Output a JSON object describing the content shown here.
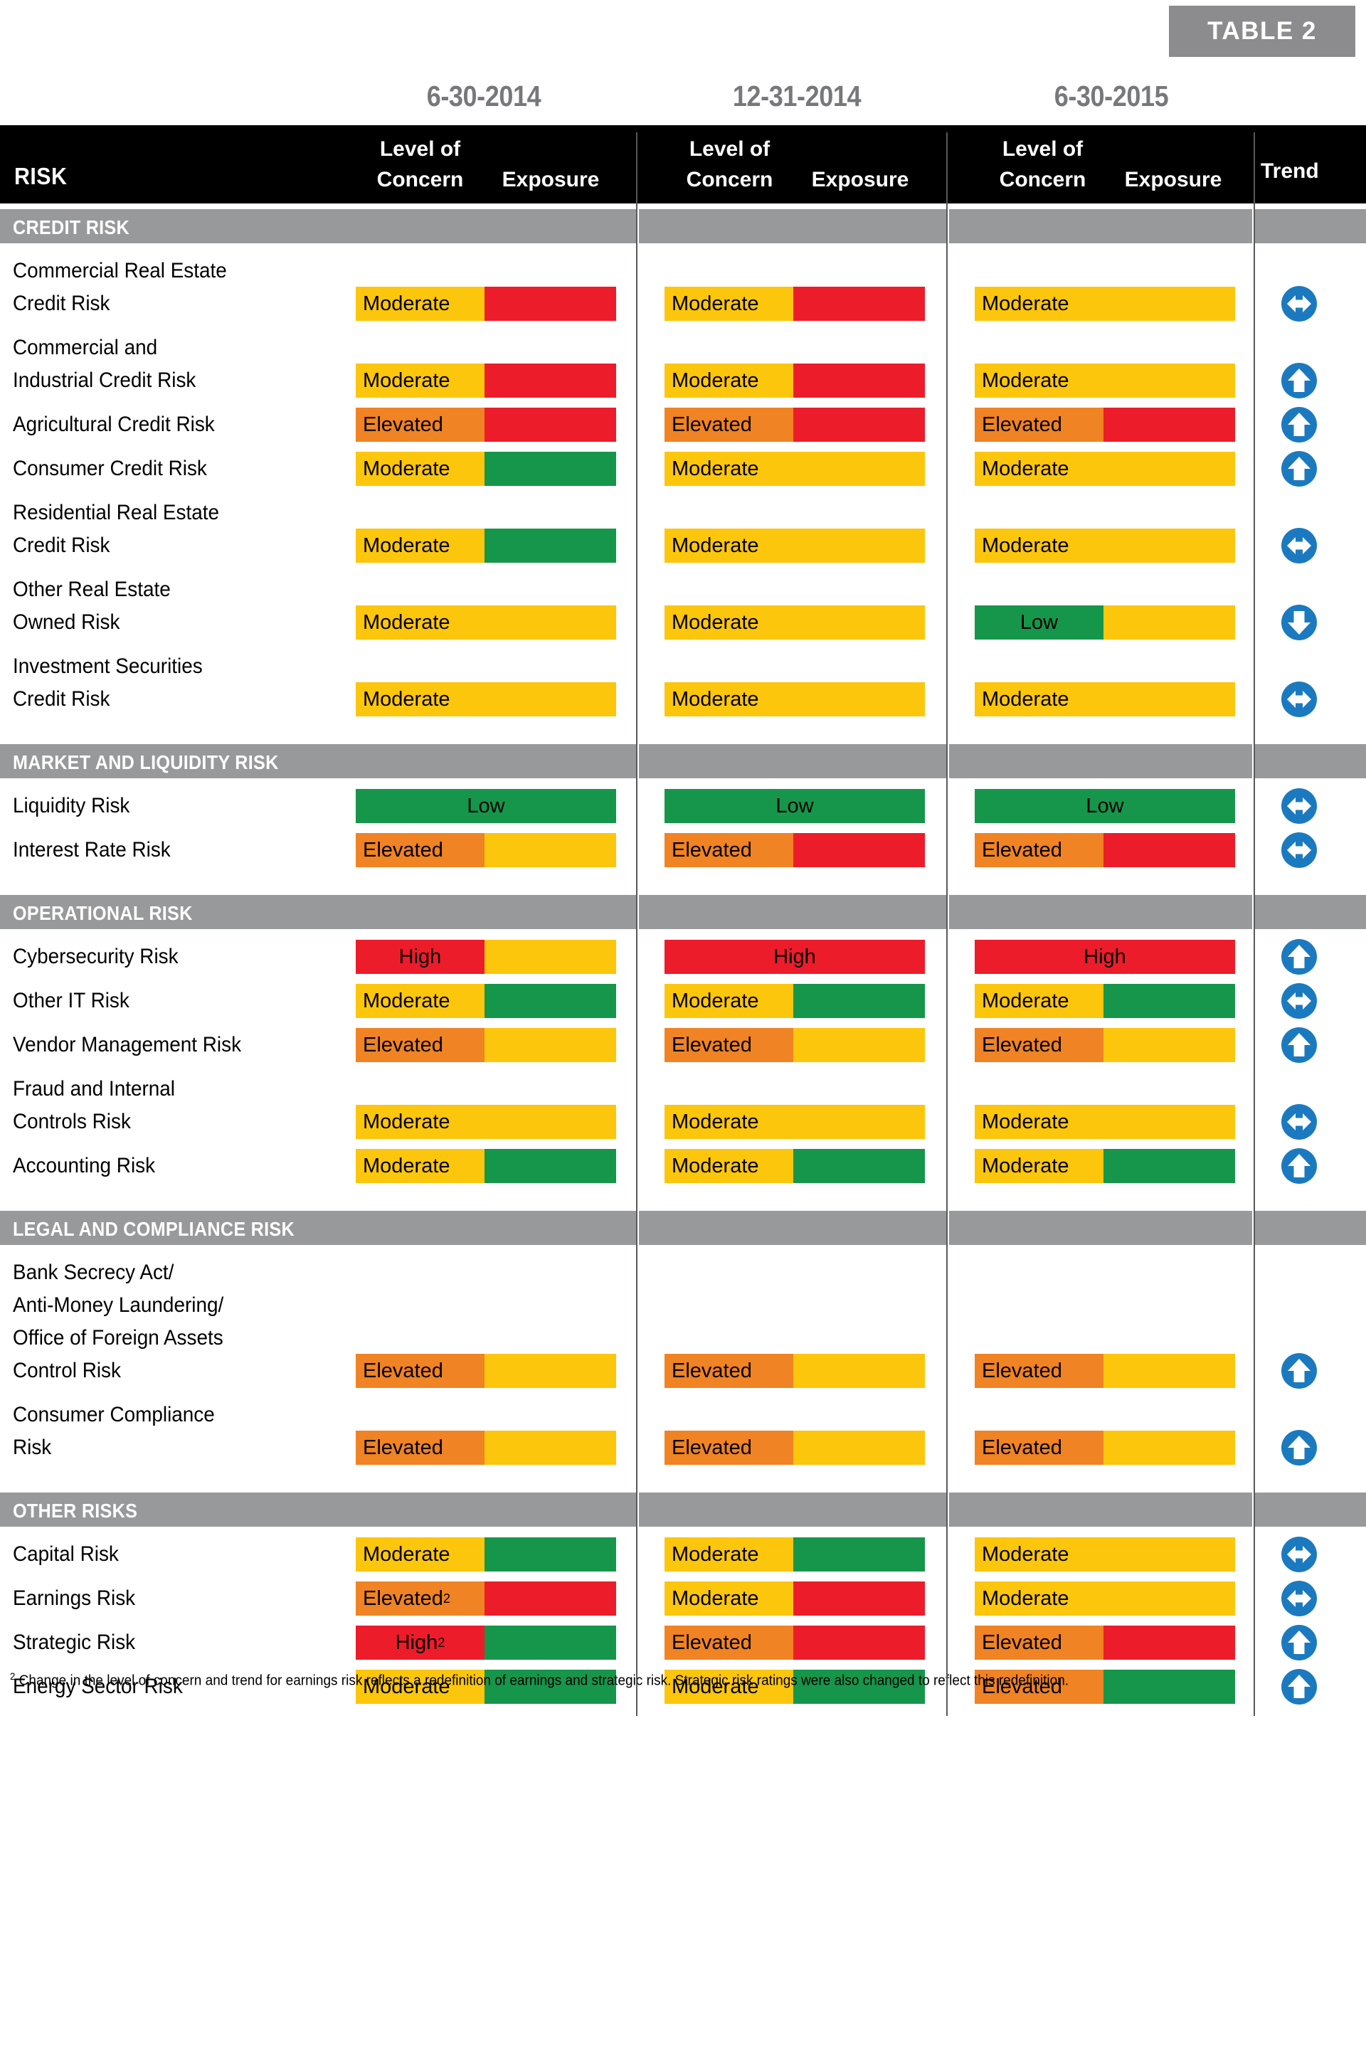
{
  "badge": {
    "label": "TABLE 2"
  },
  "colors": {
    "low": "#16964a",
    "moderate": "#fcc60c",
    "elevated": "#f08323",
    "high": "#ed1c2a",
    "band": "#97999b",
    "header_bg": "#000000",
    "trend_blue": "#1b7abf",
    "date_text": "#77787b"
  },
  "header": {
    "risk_label": "RISK",
    "trend_label": "Trend",
    "dates": [
      "6-30-2014",
      "12-31-2014",
      "6-30-2015"
    ],
    "sub_concern": "Level of\nConcern",
    "sub_concern_line1": "Level of",
    "sub_concern_line2": "Concern",
    "sub_exposure": "Exposure"
  },
  "sections": [
    {
      "title": "CREDIT RISK",
      "rows": [
        {
          "label": "Commercial Real Estate\nCredit Risk",
          "label_lines": [
            "Commercial Real Estate",
            "Credit Risk"
          ],
          "periods": [
            {
              "concern": "Moderate",
              "concern_color": "moderate",
              "exposure_color": "high"
            },
            {
              "concern": "Moderate",
              "concern_color": "moderate",
              "exposure_color": "high"
            },
            {
              "concern": "Moderate",
              "concern_color": "moderate",
              "exposure_color": "moderate"
            }
          ],
          "trend": "flat"
        },
        {
          "label": "Commercial and\nIndustrial Credit Risk",
          "label_lines": [
            "Commercial and",
            "Industrial Credit Risk"
          ],
          "periods": [
            {
              "concern": "Moderate",
              "concern_color": "moderate",
              "exposure_color": "high"
            },
            {
              "concern": "Moderate",
              "concern_color": "moderate",
              "exposure_color": "high"
            },
            {
              "concern": "Moderate",
              "concern_color": "moderate",
              "exposure_color": "moderate"
            }
          ],
          "trend": "up"
        },
        {
          "label": "Agricultural Credit Risk",
          "label_lines": [
            "Agricultural Credit Risk"
          ],
          "periods": [
            {
              "concern": "Elevated",
              "concern_color": "elevated",
              "exposure_color": "high"
            },
            {
              "concern": "Elevated",
              "concern_color": "elevated",
              "exposure_color": "high"
            },
            {
              "concern": "Elevated",
              "concern_color": "elevated",
              "exposure_color": "high"
            }
          ],
          "trend": "up"
        },
        {
          "label": "Consumer Credit Risk",
          "label_lines": [
            "Consumer Credit Risk"
          ],
          "periods": [
            {
              "concern": "Moderate",
              "concern_color": "moderate",
              "exposure_color": "low"
            },
            {
              "concern": "Moderate",
              "concern_color": "moderate",
              "exposure_color": "moderate"
            },
            {
              "concern": "Moderate",
              "concern_color": "moderate",
              "exposure_color": "moderate"
            }
          ],
          "trend": "up"
        },
        {
          "label": "Residential Real Estate\nCredit Risk",
          "label_lines": [
            "Residential Real Estate",
            "Credit Risk"
          ],
          "periods": [
            {
              "concern": "Moderate",
              "concern_color": "moderate",
              "exposure_color": "low"
            },
            {
              "concern": "Moderate",
              "concern_color": "moderate",
              "exposure_color": "moderate"
            },
            {
              "concern": "Moderate",
              "concern_color": "moderate",
              "exposure_color": "moderate"
            }
          ],
          "trend": "flat"
        },
        {
          "label": "Other Real Estate\nOwned Risk",
          "label_lines": [
            "Other Real Estate",
            "Owned Risk"
          ],
          "periods": [
            {
              "concern": "Moderate",
              "concern_color": "moderate",
              "exposure_color": "moderate"
            },
            {
              "concern": "Moderate",
              "concern_color": "moderate",
              "exposure_color": "moderate"
            },
            {
              "concern": "Low",
              "concern_color": "low",
              "exposure_color": "moderate",
              "center": true
            }
          ],
          "trend": "down"
        },
        {
          "label": "Investment Securities\nCredit Risk",
          "label_lines": [
            "Investment Securities",
            "Credit Risk"
          ],
          "periods": [
            {
              "concern": "Moderate",
              "concern_color": "moderate",
              "exposure_color": "moderate"
            },
            {
              "concern": "Moderate",
              "concern_color": "moderate",
              "exposure_color": "moderate"
            },
            {
              "concern": "Moderate",
              "concern_color": "moderate",
              "exposure_color": "moderate"
            }
          ],
          "trend": "flat"
        }
      ]
    },
    {
      "title": "MARKET AND LIQUIDITY RISK",
      "rows": [
        {
          "label": "Liquidity Risk",
          "label_lines": [
            "Liquidity Risk"
          ],
          "periods": [
            {
              "concern": "Low",
              "concern_color": "low",
              "exposure_color": "low",
              "center": true
            },
            {
              "concern": "Low",
              "concern_color": "low",
              "exposure_color": "low",
              "center": true
            },
            {
              "concern": "Low",
              "concern_color": "low",
              "exposure_color": "low",
              "center": true
            }
          ],
          "trend": "flat"
        },
        {
          "label": "Interest Rate Risk",
          "label_lines": [
            "Interest Rate Risk"
          ],
          "periods": [
            {
              "concern": "Elevated",
              "concern_color": "elevated",
              "exposure_color": "moderate"
            },
            {
              "concern": "Elevated",
              "concern_color": "elevated",
              "exposure_color": "high"
            },
            {
              "concern": "Elevated",
              "concern_color": "elevated",
              "exposure_color": "high"
            }
          ],
          "trend": "flat"
        }
      ]
    },
    {
      "title": "OPERATIONAL RISK",
      "rows": [
        {
          "label": "Cybersecurity Risk",
          "label_lines": [
            "Cybersecurity Risk"
          ],
          "periods": [
            {
              "concern": "High",
              "concern_color": "high",
              "exposure_color": "moderate",
              "center": true
            },
            {
              "concern": "High",
              "concern_color": "high",
              "exposure_color": "high",
              "center": true
            },
            {
              "concern": "High",
              "concern_color": "high",
              "exposure_color": "high",
              "center": true
            }
          ],
          "trend": "up"
        },
        {
          "label": "Other IT Risk",
          "label_lines": [
            "Other IT Risk"
          ],
          "periods": [
            {
              "concern": "Moderate",
              "concern_color": "moderate",
              "exposure_color": "low"
            },
            {
              "concern": "Moderate",
              "concern_color": "moderate",
              "exposure_color": "low"
            },
            {
              "concern": "Moderate",
              "concern_color": "moderate",
              "exposure_color": "low"
            }
          ],
          "trend": "flat"
        },
        {
          "label": "Vendor Management Risk",
          "label_lines": [
            "Vendor Management Risk"
          ],
          "periods": [
            {
              "concern": "Elevated",
              "concern_color": "elevated",
              "exposure_color": "moderate"
            },
            {
              "concern": "Elevated",
              "concern_color": "elevated",
              "exposure_color": "moderate"
            },
            {
              "concern": "Elevated",
              "concern_color": "elevated",
              "exposure_color": "moderate"
            }
          ],
          "trend": "up"
        },
        {
          "label": "Fraud and Internal\nControls Risk",
          "label_lines": [
            "Fraud and Internal",
            "Controls Risk"
          ],
          "periods": [
            {
              "concern": "Moderate",
              "concern_color": "moderate",
              "exposure_color": "moderate"
            },
            {
              "concern": "Moderate",
              "concern_color": "moderate",
              "exposure_color": "moderate"
            },
            {
              "concern": "Moderate",
              "concern_color": "moderate",
              "exposure_color": "moderate"
            }
          ],
          "trend": "flat"
        },
        {
          "label": "Accounting Risk",
          "label_lines": [
            "Accounting Risk"
          ],
          "periods": [
            {
              "concern": "Moderate",
              "concern_color": "moderate",
              "exposure_color": "low"
            },
            {
              "concern": "Moderate",
              "concern_color": "moderate",
              "exposure_color": "low"
            },
            {
              "concern": "Moderate",
              "concern_color": "moderate",
              "exposure_color": "low"
            }
          ],
          "trend": "up"
        }
      ]
    },
    {
      "title": "LEGAL AND COMPLIANCE RISK",
      "rows": [
        {
          "label": "Bank Secrecy Act/\nAnti-Money Laundering/\nOffice of Foreign Assets\nControl Risk",
          "label_lines": [
            "Bank Secrecy Act/",
            "Anti-Money Laundering/",
            "Office of Foreign Assets",
            "Control Risk"
          ],
          "periods": [
            {
              "concern": "Elevated",
              "concern_color": "elevated",
              "exposure_color": "moderate"
            },
            {
              "concern": "Elevated",
              "concern_color": "elevated",
              "exposure_color": "moderate"
            },
            {
              "concern": "Elevated",
              "concern_color": "elevated",
              "exposure_color": "moderate"
            }
          ],
          "trend": "up"
        },
        {
          "label": "Consumer Compliance\nRisk",
          "label_lines": [
            "Consumer Compliance",
            "Risk"
          ],
          "periods": [
            {
              "concern": "Elevated",
              "concern_color": "elevated",
              "exposure_color": "moderate"
            },
            {
              "concern": "Elevated",
              "concern_color": "elevated",
              "exposure_color": "moderate"
            },
            {
              "concern": "Elevated",
              "concern_color": "elevated",
              "exposure_color": "moderate"
            }
          ],
          "trend": "up"
        }
      ]
    },
    {
      "title": "OTHER RISKS",
      "rows": [
        {
          "label": "Capital Risk",
          "label_lines": [
            "Capital Risk"
          ],
          "periods": [
            {
              "concern": "Moderate",
              "concern_color": "moderate",
              "exposure_color": "low"
            },
            {
              "concern": "Moderate",
              "concern_color": "moderate",
              "exposure_color": "low"
            },
            {
              "concern": "Moderate",
              "concern_color": "moderate",
              "exposure_color": "moderate"
            }
          ],
          "trend": "flat"
        },
        {
          "label": "Earnings Risk",
          "label_lines": [
            "Earnings Risk"
          ],
          "periods": [
            {
              "concern": "Elevated",
              "footnote": "2",
              "concern_color": "elevated",
              "exposure_color": "high"
            },
            {
              "concern": "Moderate",
              "concern_color": "moderate",
              "exposure_color": "high"
            },
            {
              "concern": "Moderate",
              "concern_color": "moderate",
              "exposure_color": "moderate"
            }
          ],
          "trend": "flat"
        },
        {
          "label": "Strategic Risk",
          "label_lines": [
            "Strategic Risk"
          ],
          "periods": [
            {
              "concern": "High",
              "footnote": "2",
              "concern_color": "high",
              "exposure_color": "low",
              "center": true
            },
            {
              "concern": "Elevated",
              "concern_color": "elevated",
              "exposure_color": "high"
            },
            {
              "concern": "Elevated",
              "concern_color": "elevated",
              "exposure_color": "high"
            }
          ],
          "trend": "up"
        },
        {
          "label": "Energy Sector Risk",
          "label_lines": [
            "Energy Sector Risk"
          ],
          "periods": [
            {
              "concern": "Moderate",
              "concern_color": "moderate",
              "exposure_color": "low"
            },
            {
              "concern": "Moderate",
              "concern_color": "moderate",
              "exposure_color": "low"
            },
            {
              "concern": "Elevated",
              "concern_color": "elevated",
              "exposure_color": "low"
            }
          ],
          "trend": "up"
        }
      ]
    }
  ],
  "footnote": {
    "marker": "2",
    "text": " Change in the level of concern and trend for earnings risk reflects a redefinition of earnings and strategic risk. Strategic risk ratings were also changed to reflect this redefinition."
  }
}
